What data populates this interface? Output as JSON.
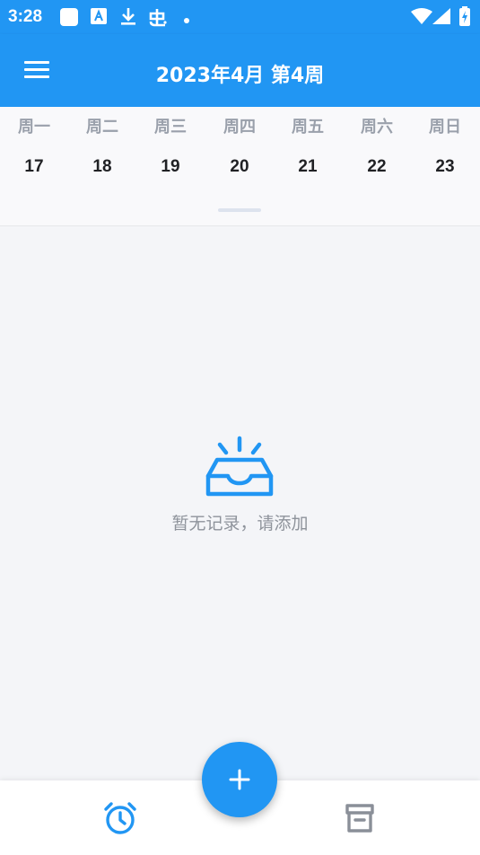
{
  "status_bar": {
    "time": "3:28",
    "icons": [
      "notification-square-icon",
      "font-a-icon",
      "download-icon",
      "bug-icon",
      "dot-icon",
      "wifi-icon",
      "cell-signal-icon",
      "battery-charging-icon"
    ]
  },
  "app_bar": {
    "title": "2023年4月 第4周",
    "menu_icon": "hamburger-menu-icon"
  },
  "week": {
    "days": [
      {
        "weekday": "周一",
        "date": "17"
      },
      {
        "weekday": "周二",
        "date": "18"
      },
      {
        "weekday": "周三",
        "date": "19"
      },
      {
        "weekday": "周四",
        "date": "20"
      },
      {
        "weekday": "周五",
        "date": "21"
      },
      {
        "weekday": "周六",
        "date": "22"
      },
      {
        "weekday": "周日",
        "date": "23"
      }
    ]
  },
  "empty_state": {
    "icon": "empty-inbox-icon",
    "message": "暂无记录，请添加"
  },
  "bottom_nav": {
    "left_icon": "alarm-clock-icon",
    "right_icon": "archive-box-icon",
    "fab_icon": "plus-icon"
  },
  "colors": {
    "primary": "#2196f3",
    "background": "#f4f5f8",
    "weekday_text": "#9aa0ab",
    "date_text": "#202124",
    "empty_text": "#8e939b",
    "nav_inactive": "#8a8f98"
  }
}
